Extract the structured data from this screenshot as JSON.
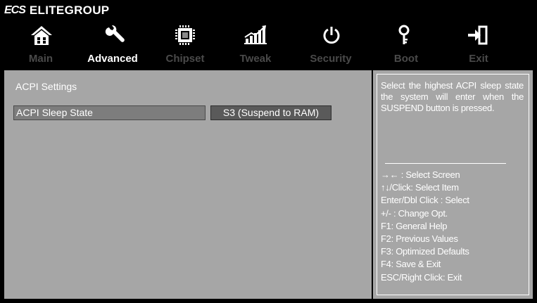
{
  "header": {
    "brand_logo": "ECS",
    "brand_name": "ELITEGROUP"
  },
  "icons": [
    {
      "name": "home-icon"
    },
    {
      "name": "wrench-icon"
    },
    {
      "name": "chip-icon"
    },
    {
      "name": "tweak-graph-icon"
    },
    {
      "name": "power-icon"
    },
    {
      "name": "key-icon"
    },
    {
      "name": "exit-icon"
    }
  ],
  "tabs": [
    {
      "label": "Main",
      "active": false
    },
    {
      "label": "Advanced",
      "active": true
    },
    {
      "label": "Chipset",
      "active": false
    },
    {
      "label": "Tweak",
      "active": false
    },
    {
      "label": "Security",
      "active": false
    },
    {
      "label": "Boot",
      "active": false
    },
    {
      "label": "Exit",
      "active": false
    }
  ],
  "main": {
    "section_title": "ACPI Settings",
    "setting": {
      "label": "ACPI Sleep State",
      "value": "S3 (Suspend to RAM)"
    }
  },
  "help": {
    "description": "Select the highest ACPI sleep state the system will enter when the SUSPEND button is pressed.",
    "keys": [
      "→←  : Select Screen",
      "↑↓/Click: Select Item",
      "Enter/Dbl Click : Select",
      "+/- : Change Opt.",
      "F1: General Help",
      "F2: Previous Values",
      "F3: Optimized Defaults",
      "F4: Save & Exit",
      "ESC/Right Click: Exit"
    ]
  },
  "colors": {
    "background": "#000000",
    "panel": "#a6a6a6",
    "tab_inactive": "#4a4a4a",
    "tab_active": "#ffffff"
  }
}
